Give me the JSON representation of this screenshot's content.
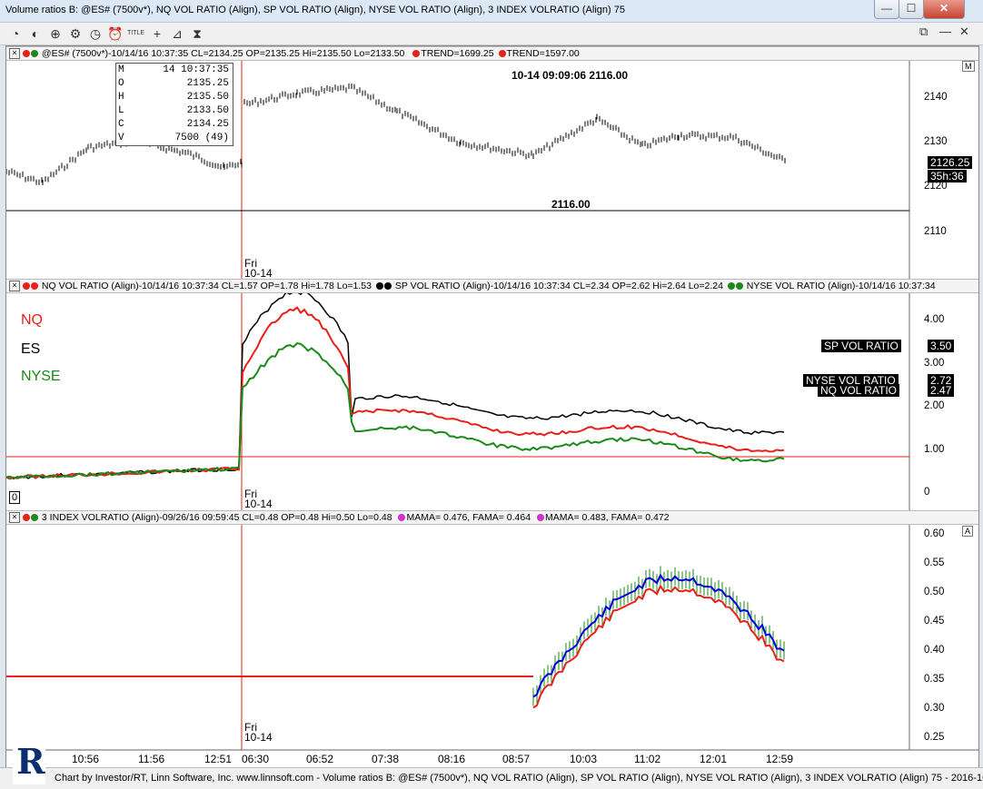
{
  "window": {
    "title": "Volume ratios B: @ES# (7500v*), NQ VOL RATIO (Align), SP VOL RATIO (Align), NYSE VOL RATIO (Align), 3 INDEX VOLRATIO (Align) 75",
    "minimize": "—",
    "maximize": "☐",
    "close": "✕"
  },
  "toolbar": {
    "icons": [
      "pie-icon",
      "trend-icon",
      "zoom-icon",
      "gear-icon",
      "clock-settings-icon",
      "alarm-clock-icon",
      "title-icon",
      "crosshair-icon",
      "draw-icon",
      "hourglass-icon"
    ],
    "title_label": "TITLE",
    "restore": "⧉",
    "min": "—",
    "close": "✕"
  },
  "pane1": {
    "header": "@ES# (7500v*)-10/14/16 10:37:35 CL=2134.25 OP=2135.25 Hi=2135.50 Lo=2133.50",
    "trend1": "TREND=1699.25",
    "trend2": "TREND=1597.00",
    "m_badge": "M",
    "timestamp_label": "10-14 09:09:06  2116.00",
    "line_label": "2116.00",
    "price_label": "2126.25",
    "timer_label": "35h:36",
    "yticks": [
      "2140",
      "2130",
      "2120",
      "2110"
    ],
    "info": [
      {
        "k": "M",
        "v": "14 10:37:35"
      },
      {
        "k": "O",
        "v": "2135.25"
      },
      {
        "k": "H",
        "v": "2135.50"
      },
      {
        "k": "L",
        "v": "2133.50"
      },
      {
        "k": "C",
        "v": "2134.25"
      },
      {
        "k": "V",
        "v": "7500 (49)"
      }
    ],
    "day_label": "Fri",
    "date_label": "10-14"
  },
  "pane2": {
    "header_nq": "NQ VOL RATIO (Align)-10/14/16 10:37:34 CL=1.57 OP=1.78 Hi=1.78 Lo=1.53",
    "header_sp": "SP VOL RATIO (Align)-10/14/16 10:37:34 CL=2.34 OP=2.62 Hi=2.64 Lo=2.24",
    "header_nyse": "NYSE VOL RATIO (Align)-10/14/16 10:37:34",
    "legend_nq": "NQ",
    "legend_es": "ES",
    "legend_nyse": "NYSE",
    "sp_label": "SP VOL RATIO",
    "sp_value": "3.50",
    "nyse_label": "NYSE VOL RATIO",
    "nyse_value": "2.72",
    "nq_label": "NQ VOL RATIO",
    "nq_value": "2.47",
    "yticks": [
      "4.00",
      "3.00",
      "2.00",
      "1.00",
      "0"
    ],
    "zero_box": "0",
    "day_label": "Fri",
    "date_label": "10-14",
    "colors": {
      "nq": "#e8201a",
      "sp": "#000000",
      "nyse": "#1a8a1a"
    }
  },
  "pane3": {
    "header": "3 INDEX VOLRATIO (Align)-09/26/16 09:59:45 CL=0.48 OP=0.48 Hi=0.50 Lo=0.48",
    "mama1": "MAMA=  0.476, FAMA=  0.464",
    "mama2": "MAMA=  0.483, FAMA=  0.472",
    "a_badge": "A",
    "yticks": [
      "0.60",
      "0.55",
      "0.50",
      "0.45",
      "0.40",
      "0.35",
      "0.30",
      "0.25"
    ],
    "day_label": "Fri",
    "date_label": "10-14"
  },
  "xaxis": [
    "10:56",
    "11:56",
    "12:51",
    "06:30",
    "06:52",
    "07:38",
    "08:16",
    "08:57",
    "10:03",
    "11:02",
    "12:01",
    "12:59"
  ],
  "footer": "Chart by Investor/RT, Linn Software, Inc. www.linnsoft.com - Volume ratios B: @ES# (7500v*), NQ VOL RATIO (Align), SP VOL RATIO (Align), NYSE VOL RATIO (Align), 3 INDEX VOLRATIO (Align) 75 - 2016-10-1",
  "logo_letter": "R"
}
